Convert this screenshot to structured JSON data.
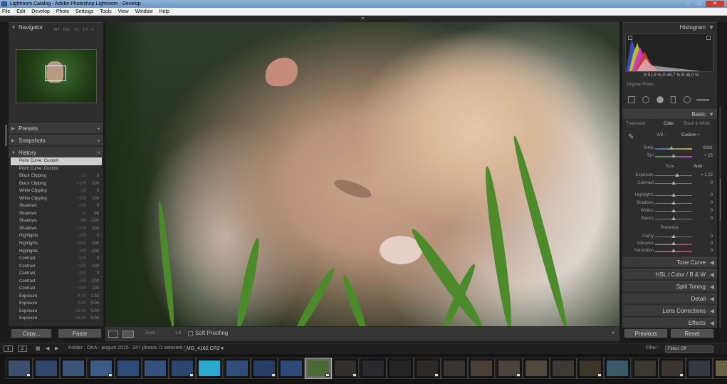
{
  "titlebar": {
    "title": "Lightroom Catalog - Adobe Photoshop Lightroom - Develop",
    "min": "–",
    "max": "□",
    "close": "✕"
  },
  "menu": [
    "File",
    "Edit",
    "Develop",
    "Photo",
    "Settings",
    "Tools",
    "View",
    "Window",
    "Help"
  ],
  "left": {
    "navigator": {
      "title": "Navigator",
      "opts": "FIT FILL 1:1 1:2 ▾"
    },
    "presets": "Presets",
    "snapshots": "Snapshots",
    "history_title": "History",
    "history": [
      {
        "label": "Point Curve: Custom",
        "a": "",
        "b": ""
      },
      {
        "label": "Point Curve: Custom",
        "a": "",
        "b": ""
      },
      {
        "label": "Black Clipping",
        "a": "-11",
        "b": "0"
      },
      {
        "label": "Black Clipping",
        "a": "+100",
        "b": "100"
      },
      {
        "label": "White Clipping",
        "a": "-18",
        "b": "0"
      },
      {
        "label": "White Clipping",
        "a": "+100",
        "b": "100"
      },
      {
        "label": "Shadows",
        "a": "-100",
        "b": "0"
      },
      {
        "label": "Shadows",
        "a": "+2",
        "b": "98"
      },
      {
        "label": "Shadows",
        "a": "-98",
        "b": "-100"
      },
      {
        "label": "Shadows",
        "a": "+100",
        "b": "100"
      },
      {
        "label": "Highlights",
        "a": "-100",
        "b": "0"
      },
      {
        "label": "Highlights",
        "a": "+200",
        "b": "100"
      },
      {
        "label": "Highlights",
        "a": "-100",
        "b": "-100"
      },
      {
        "label": "Contrast",
        "a": "-100",
        "b": "0"
      },
      {
        "label": "Contrast",
        "a": "+100",
        "b": "100"
      },
      {
        "label": "Contrast",
        "a": "-100",
        "b": "0"
      },
      {
        "label": "Contrast",
        "a": "-100",
        "b": "-100"
      },
      {
        "label": "Contrast",
        "a": "+100",
        "b": "100"
      },
      {
        "label": "Exposure",
        "a": "-4.00",
        "b": "1.02"
      },
      {
        "label": "Exposure",
        "a": "-5.02",
        "b": "5.00"
      },
      {
        "label": "Exposure",
        "a": "+5.00",
        "b": "0.00"
      },
      {
        "label": "Exposure",
        "a": "+5.00",
        "b": "5.00"
      }
    ],
    "copy": "Copy...",
    "paste": "Paste"
  },
  "toolbar": {
    "zoom_label": "Zoom",
    "zoom_value": "1:8",
    "soft_proofing": "Soft Proofing"
  },
  "right": {
    "histogram": "Histogram",
    "readout": "R 51,9 % G 48,7 % B 45,0 %",
    "original_photo": "Original Photo",
    "basic": "Basic",
    "treatment_label": "Treatment :",
    "treatment_color": "Color",
    "treatment_bw": "Black & White",
    "wb_label": "WB :",
    "wb_value": "Custom ÷",
    "temp": {
      "label": "Temp",
      "value": "6091"
    },
    "tint": {
      "label": "Tint",
      "value": "+ 25"
    },
    "tone": "Tone",
    "auto": "Auto",
    "exposure": {
      "label": "Exposure",
      "value": "+ 1,02"
    },
    "contrast": {
      "label": "Contrast",
      "value": "0"
    },
    "highlights": {
      "label": "Highlights",
      "value": "0"
    },
    "shadows": {
      "label": "Shadows",
      "value": "0"
    },
    "whites": {
      "label": "Whites",
      "value": "0"
    },
    "blacks": {
      "label": "Blacks",
      "value": "0"
    },
    "presence": "Presence",
    "clarity": {
      "label": "Clarity",
      "value": "0"
    },
    "vibrance": {
      "label": "Vibrance",
      "value": "0"
    },
    "saturation": {
      "label": "Saturation",
      "value": "0"
    },
    "tone_curve": "Tone Curve",
    "hsl": "HSL / Color / B & W",
    "split_toning": "Split Toning",
    "detail": "Detail",
    "lens": "Lens Corrections",
    "effects": "Effects",
    "previous": "Previous",
    "reset": "Reset"
  },
  "film": {
    "page1": "1",
    "page2": "2",
    "folder": "Folder : OKA - august 2015",
    "count": "247 photos /1 selected /",
    "filename": "_MG_4162.CR2 ▾",
    "filter_label": "Filter :",
    "filter_value": "Filters Off"
  },
  "thumb_colors": [
    "#3c4f6e",
    "#30466a",
    "#3a5579",
    "#3c5a86",
    "#2e4a77",
    "#35527f",
    "#2a4670",
    "#2ea7cf",
    "#2f4d78",
    "#263e66",
    "#2c4a78",
    "#4a6a33",
    "#32302a",
    "#2a2a2e",
    "#242426",
    "#2e2a27",
    "#3a3430",
    "#4a4038",
    "#4c4338",
    "#51483c",
    "#3c3a33",
    "#3a3628",
    "#3a5a6a",
    "#3c3830",
    "#3a342e",
    "#34383e",
    "#6a6242"
  ]
}
